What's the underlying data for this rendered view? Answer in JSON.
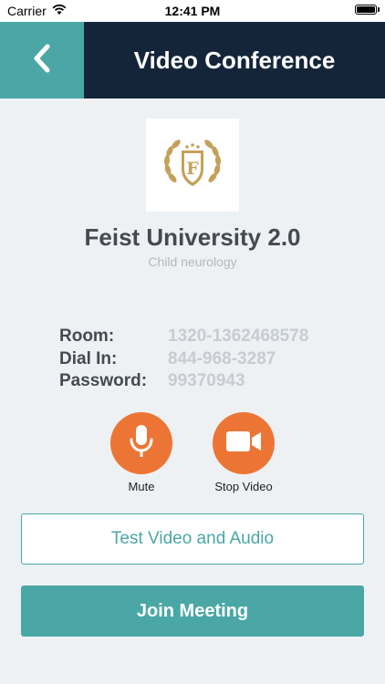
{
  "status_bar": {
    "carrier": "Carrier",
    "time": "12:41 PM"
  },
  "header": {
    "title": "Video Conference",
    "back_icon": "chevron-left-icon"
  },
  "organization": {
    "name": "Feist University 2.0",
    "subtitle": "Child neurology",
    "logo_letter": "F"
  },
  "conference": {
    "room_label": "Room:",
    "room_value": "1320-1362468578",
    "dial_label": "Dial In:",
    "dial_value": "844-968-3287",
    "password_label": "Password:",
    "password_value": "99370943"
  },
  "controls": {
    "mute_label": "Mute",
    "stop_video_label": "Stop Video"
  },
  "actions": {
    "test_label": "Test Video and Audio",
    "join_label": "Join Meeting"
  },
  "colors": {
    "accent_teal": "#4aa7a6",
    "nav_dark": "#14253a",
    "control_orange": "#ec7536",
    "logo_gold": "#c4a15a"
  }
}
